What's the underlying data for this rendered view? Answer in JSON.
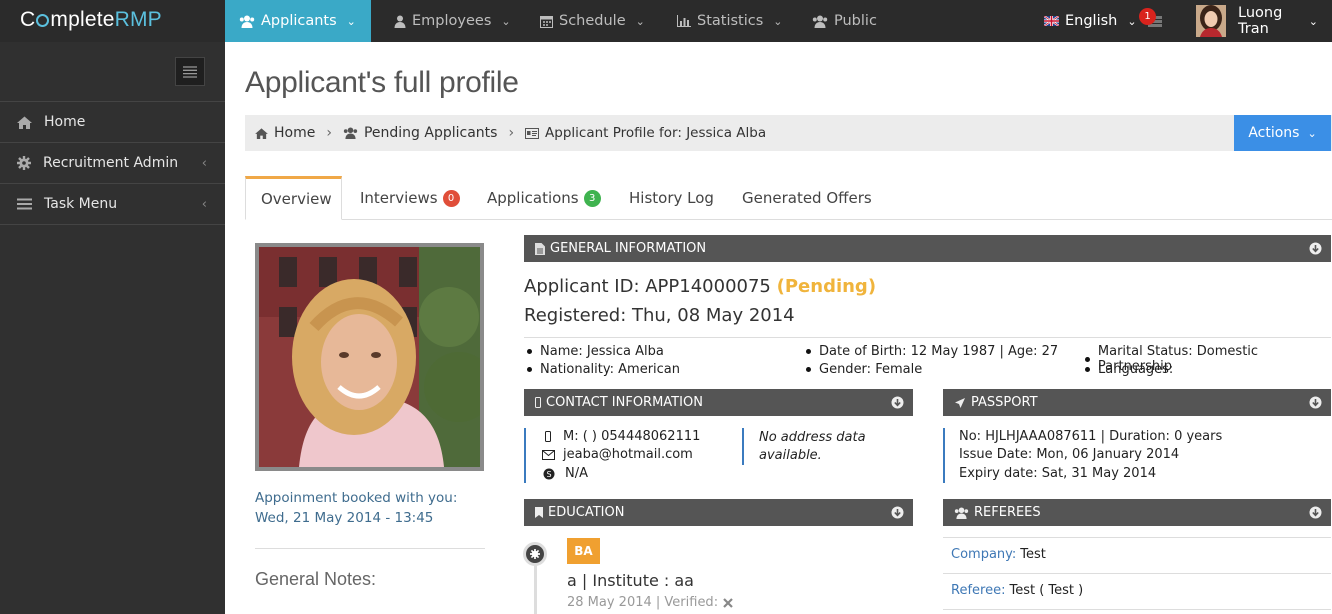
{
  "brand": {
    "logo_text_1": "C",
    "logo_text_2": "mplete",
    "logo_text_3": "RMP"
  },
  "colors": {
    "accent": "#3aa9c7",
    "actions": "#3b8fe6",
    "pending": "#f0b43c",
    "interviews_badge": "#e04e39",
    "applications_badge": "#3fb34f",
    "education_badge": "#f0a030"
  },
  "topnav": {
    "items": [
      {
        "label": "Applicants",
        "icon": "users-icon"
      },
      {
        "label": "Employees",
        "icon": "user-icon"
      },
      {
        "label": "Schedule",
        "icon": "calendar-icon"
      },
      {
        "label": "Statistics",
        "icon": "bar-chart-icon"
      },
      {
        "label": "Public",
        "icon": "users-icon"
      }
    ],
    "language": "English",
    "notification_count": "1",
    "user_name": "Luong Tran"
  },
  "sidebar": {
    "items": [
      {
        "label": "Home",
        "icon": "home-icon"
      },
      {
        "label": "Recruitment Admin",
        "icon": "gear-icon"
      },
      {
        "label": "Task Menu",
        "icon": "list-icon"
      }
    ]
  },
  "page": {
    "title": "Applicant's full profile"
  },
  "breadcrumb": {
    "home": "Home",
    "pending": "Pending Applicants",
    "current": "Applicant Profile for: Jessica Alba",
    "actions_label": "Actions"
  },
  "tabs": [
    {
      "label": "Overview"
    },
    {
      "label": "Interviews",
      "badge": "0"
    },
    {
      "label": "Applications",
      "badge": "3"
    },
    {
      "label": "History Log"
    },
    {
      "label": "Generated Offers"
    }
  ],
  "left": {
    "appointment_line1": "Appoinment booked with you:",
    "appointment_line2": "Wed, 21 May 2014 - 13:45",
    "notes_title": "General Notes:"
  },
  "general": {
    "header": "GENERAL INFORMATION",
    "applicant_id": "Applicant ID: APP14000075",
    "status": "(Pending)",
    "registered": "Registered: Thu, 08 May 2014",
    "name": "Name: Jessica Alba",
    "nationality": "Nationality: American",
    "dob": "Date of Birth: 12 May 1987 | Age: 27",
    "gender": "Gender: Female",
    "marital": "Marital Status: Domestic Partnership",
    "languages": "Languages:"
  },
  "contact": {
    "header": "CONTACT INFORMATION",
    "mobile": "M: ( ) 054448062111",
    "email": "jeaba@hotmail.com",
    "skype": "N/A",
    "address_line1": "No address data",
    "address_line2": "available."
  },
  "passport": {
    "header": "PASSPORT",
    "number": "No: HJLHJAAA087611 | Duration: 0 years",
    "issue": "Issue Date: Mon, 06 January 2014",
    "expiry": "Expiry date: Sat, 31 May 2014"
  },
  "education": {
    "header": "EDUCATION",
    "degree": "BA",
    "institute": "a | Institute : aa",
    "date": "28 May 2014 | Verified:"
  },
  "referees": {
    "header": "REFEREES",
    "company_label": "Company:",
    "company_value": "Test",
    "referee_label": "Referee:",
    "referee_value": "Test ( Test )"
  }
}
